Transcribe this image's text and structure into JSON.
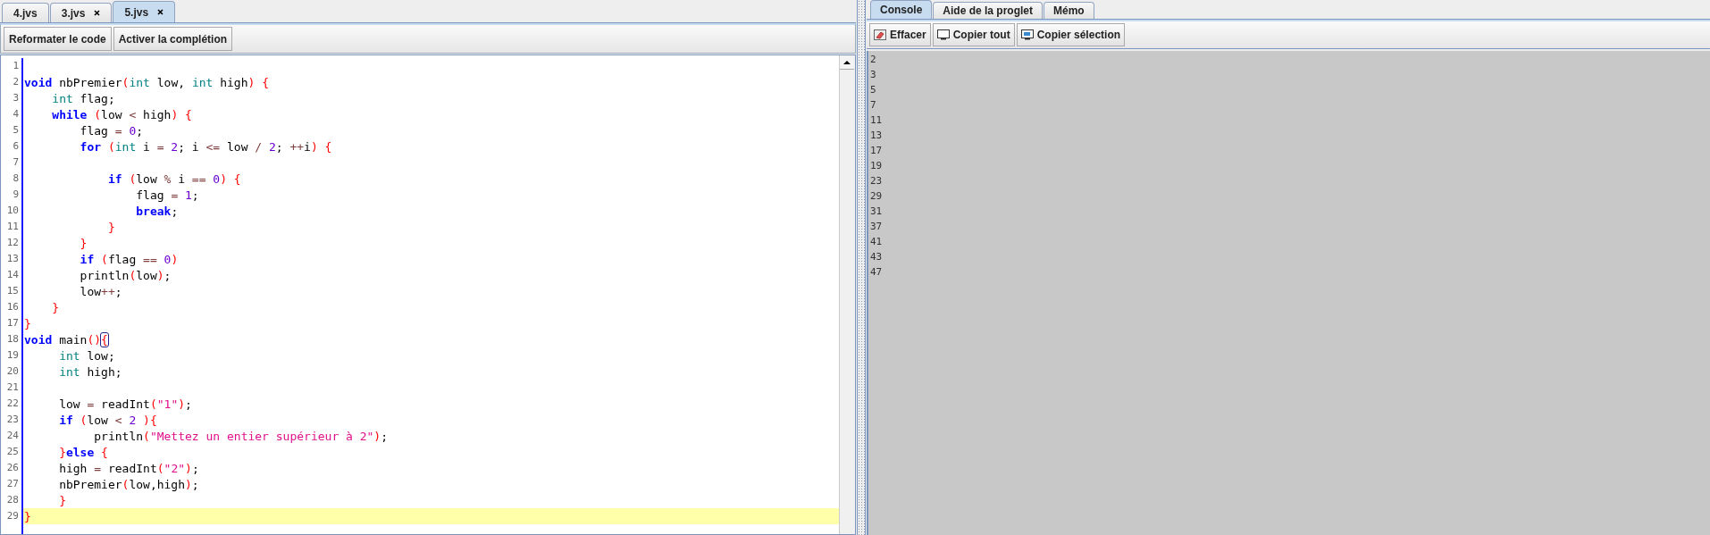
{
  "editor_tabs": [
    {
      "label": "4.jvs",
      "closable": false,
      "selected": false
    },
    {
      "label": "3.jvs",
      "closable": true,
      "selected": false
    },
    {
      "label": "5.jvs",
      "closable": true,
      "selected": true
    }
  ],
  "editor_toolbar": [
    "Reformater le code",
    "Activer la complétion"
  ],
  "code_lines": [
    {
      "number": "1",
      "current": false
    },
    {
      "number": "2",
      "current": false,
      "tokens": [
        {
          "kind": "keyword",
          "text": "void"
        },
        {
          "kind": "plain",
          "text": " nbPremier"
        },
        {
          "kind": "paren",
          "text": "("
        },
        {
          "kind": "type",
          "text": "int"
        },
        {
          "kind": "plain",
          "text": " low, "
        },
        {
          "kind": "type",
          "text": "int"
        },
        {
          "kind": "plain",
          "text": " high"
        },
        {
          "kind": "paren",
          "text": ")"
        },
        {
          "kind": "paren",
          "text": " {"
        }
      ]
    },
    {
      "number": "3",
      "current": false,
      "tokens": [
        {
          "kind": "type",
          "text": "    int"
        },
        {
          "kind": "plain",
          "text": " flag;"
        }
      ]
    },
    {
      "number": "4",
      "current": false,
      "tokens": [
        {
          "kind": "keyword",
          "text": "    while"
        },
        {
          "kind": "paren",
          "text": " ("
        },
        {
          "kind": "plain",
          "text": "low "
        },
        {
          "kind": "operator",
          "text": "<"
        },
        {
          "kind": "plain",
          "text": " high"
        },
        {
          "kind": "paren",
          "text": ")"
        },
        {
          "kind": "paren",
          "text": " {"
        }
      ]
    },
    {
      "number": "5",
      "current": false,
      "tokens": [
        {
          "kind": "plain",
          "text": "        flag "
        },
        {
          "kind": "operator",
          "text": "="
        },
        {
          "kind": "number",
          "text": " 0"
        },
        {
          "kind": "plain",
          "text": ";"
        }
      ]
    },
    {
      "number": "6",
      "current": false,
      "tokens": [
        {
          "kind": "keyword",
          "text": "        for"
        },
        {
          "kind": "paren",
          "text": " ("
        },
        {
          "kind": "type",
          "text": "int"
        },
        {
          "kind": "plain",
          "text": " i "
        },
        {
          "kind": "operator",
          "text": "="
        },
        {
          "kind": "number",
          "text": " 2"
        },
        {
          "kind": "plain",
          "text": "; i "
        },
        {
          "kind": "operator",
          "text": "<="
        },
        {
          "kind": "plain",
          "text": " low "
        },
        {
          "kind": "operator",
          "text": "/"
        },
        {
          "kind": "number",
          "text": " 2"
        },
        {
          "kind": "plain",
          "text": "; "
        },
        {
          "kind": "operator",
          "text": "++"
        },
        {
          "kind": "plain",
          "text": "i"
        },
        {
          "kind": "paren",
          "text": ")"
        },
        {
          "kind": "paren",
          "text": " {"
        }
      ]
    },
    {
      "number": "7",
      "current": false
    },
    {
      "number": "8",
      "current": false,
      "tokens": [
        {
          "kind": "keyword",
          "text": "            if"
        },
        {
          "kind": "paren",
          "text": " ("
        },
        {
          "kind": "plain",
          "text": "low "
        },
        {
          "kind": "operator",
          "text": "%"
        },
        {
          "kind": "plain",
          "text": " i "
        },
        {
          "kind": "operator",
          "text": "=="
        },
        {
          "kind": "number",
          "text": " 0"
        },
        {
          "kind": "paren",
          "text": ")"
        },
        {
          "kind": "paren",
          "text": " {"
        }
      ]
    },
    {
      "number": "9",
      "current": false,
      "tokens": [
        {
          "kind": "plain",
          "text": "                flag "
        },
        {
          "kind": "operator",
          "text": "="
        },
        {
          "kind": "number",
          "text": " 1"
        },
        {
          "kind": "plain",
          "text": ";"
        }
      ]
    },
    {
      "number": "10",
      "current": false,
      "tokens": [
        {
          "kind": "keyword",
          "text": "                break"
        },
        {
          "kind": "plain",
          "text": ";"
        }
      ]
    },
    {
      "number": "11",
      "current": false,
      "tokens": [
        {
          "kind": "paren",
          "text": "            }"
        }
      ]
    },
    {
      "number": "12",
      "current": false,
      "tokens": [
        {
          "kind": "paren",
          "text": "        }"
        }
      ]
    },
    {
      "number": "13",
      "current": false,
      "tokens": [
        {
          "kind": "keyword",
          "text": "        if"
        },
        {
          "kind": "paren",
          "text": " ("
        },
        {
          "kind": "plain",
          "text": "flag "
        },
        {
          "kind": "operator",
          "text": "=="
        },
        {
          "kind": "number",
          "text": " 0"
        },
        {
          "kind": "paren",
          "text": ")"
        }
      ]
    },
    {
      "number": "14",
      "current": false,
      "tokens": [
        {
          "kind": "plain",
          "text": "        println"
        },
        {
          "kind": "paren",
          "text": "("
        },
        {
          "kind": "plain",
          "text": "low"
        },
        {
          "kind": "paren",
          "text": ")"
        },
        {
          "kind": "plain",
          "text": ";"
        }
      ]
    },
    {
      "number": "15",
      "current": false,
      "tokens": [
        {
          "kind": "plain",
          "text": "        low"
        },
        {
          "kind": "operator",
          "text": "++"
        },
        {
          "kind": "plain",
          "text": ";"
        }
      ]
    },
    {
      "number": "16",
      "current": false,
      "tokens": [
        {
          "kind": "paren",
          "text": "    }"
        }
      ]
    },
    {
      "number": "17",
      "current": false,
      "tokens": [
        {
          "kind": "paren",
          "text": "}"
        }
      ]
    },
    {
      "number": "18",
      "current": false,
      "tokens": [
        {
          "kind": "keyword",
          "text": "void"
        },
        {
          "kind": "plain",
          "text": " main"
        },
        {
          "kind": "paren",
          "text": "()"
        },
        {
          "kind": "paren-matched",
          "text": "{"
        }
      ]
    },
    {
      "number": "19",
      "current": false,
      "tokens": [
        {
          "kind": "type",
          "text": "     int"
        },
        {
          "kind": "plain",
          "text": " low;"
        }
      ]
    },
    {
      "number": "20",
      "current": false,
      "tokens": [
        {
          "kind": "type",
          "text": "     int"
        },
        {
          "kind": "plain",
          "text": " high;"
        }
      ]
    },
    {
      "number": "21",
      "current": false
    },
    {
      "number": "22",
      "current": false,
      "tokens": [
        {
          "kind": "plain",
          "text": "     low "
        },
        {
          "kind": "operator",
          "text": "="
        },
        {
          "kind": "plain",
          "text": " readInt"
        },
        {
          "kind": "paren",
          "text": "("
        },
        {
          "kind": "string",
          "text": "\"1\""
        },
        {
          "kind": "paren",
          "text": ")"
        },
        {
          "kind": "plain",
          "text": ";"
        }
      ]
    },
    {
      "number": "23",
      "current": false,
      "tokens": [
        {
          "kind": "keyword",
          "text": "     if"
        },
        {
          "kind": "paren",
          "text": " ("
        },
        {
          "kind": "plain",
          "text": "low "
        },
        {
          "kind": "operator",
          "text": "<"
        },
        {
          "kind": "number",
          "text": " 2"
        },
        {
          "kind": "paren",
          "text": " )"
        },
        {
          "kind": "paren",
          "text": "{"
        }
      ]
    },
    {
      "number": "24",
      "current": false,
      "tokens": [
        {
          "kind": "plain",
          "text": "          println"
        },
        {
          "kind": "paren",
          "text": "("
        },
        {
          "kind": "string",
          "text": "\"Mettez un entier supérieur à 2\""
        },
        {
          "kind": "paren",
          "text": ")"
        },
        {
          "kind": "plain",
          "text": ";"
        }
      ]
    },
    {
      "number": "25",
      "current": false,
      "tokens": [
        {
          "kind": "paren",
          "text": "     }"
        },
        {
          "kind": "keyword",
          "text": "else"
        },
        {
          "kind": "paren",
          "text": " {"
        }
      ]
    },
    {
      "number": "26",
      "current": false,
      "tokens": [
        {
          "kind": "plain",
          "text": "     high "
        },
        {
          "kind": "operator",
          "text": "="
        },
        {
          "kind": "plain",
          "text": " readInt"
        },
        {
          "kind": "paren",
          "text": "("
        },
        {
          "kind": "string",
          "text": "\"2\""
        },
        {
          "kind": "paren",
          "text": ")"
        },
        {
          "kind": "plain",
          "text": ";"
        }
      ]
    },
    {
      "number": "27",
      "current": false,
      "tokens": [
        {
          "kind": "plain",
          "text": "     nbPremier"
        },
        {
          "kind": "paren",
          "text": "("
        },
        {
          "kind": "plain",
          "text": "low,high"
        },
        {
          "kind": "paren",
          "text": ")"
        },
        {
          "kind": "plain",
          "text": ";"
        }
      ]
    },
    {
      "number": "28",
      "current": false,
      "tokens": [
        {
          "kind": "paren",
          "text": "     }"
        }
      ]
    },
    {
      "number": "29",
      "current": true,
      "tokens": [
        {
          "kind": "paren",
          "text": "}"
        }
      ]
    }
  ],
  "console_tabs": [
    {
      "label": "Console",
      "selected": true
    },
    {
      "label": "Aide de la proglet",
      "selected": false
    },
    {
      "label": "Mémo",
      "selected": false
    }
  ],
  "console_toolbar": [
    {
      "kind": "clear",
      "label": "Effacer"
    },
    {
      "kind": "copy-all",
      "label": "Copier tout"
    },
    {
      "kind": "copy-selection",
      "label": "Copier sélection"
    }
  ],
  "console_output": [
    "2",
    "3",
    "5",
    "7",
    "11",
    "13",
    "17",
    "19",
    "23",
    "29",
    "31",
    "37",
    "41",
    "43",
    "47"
  ]
}
